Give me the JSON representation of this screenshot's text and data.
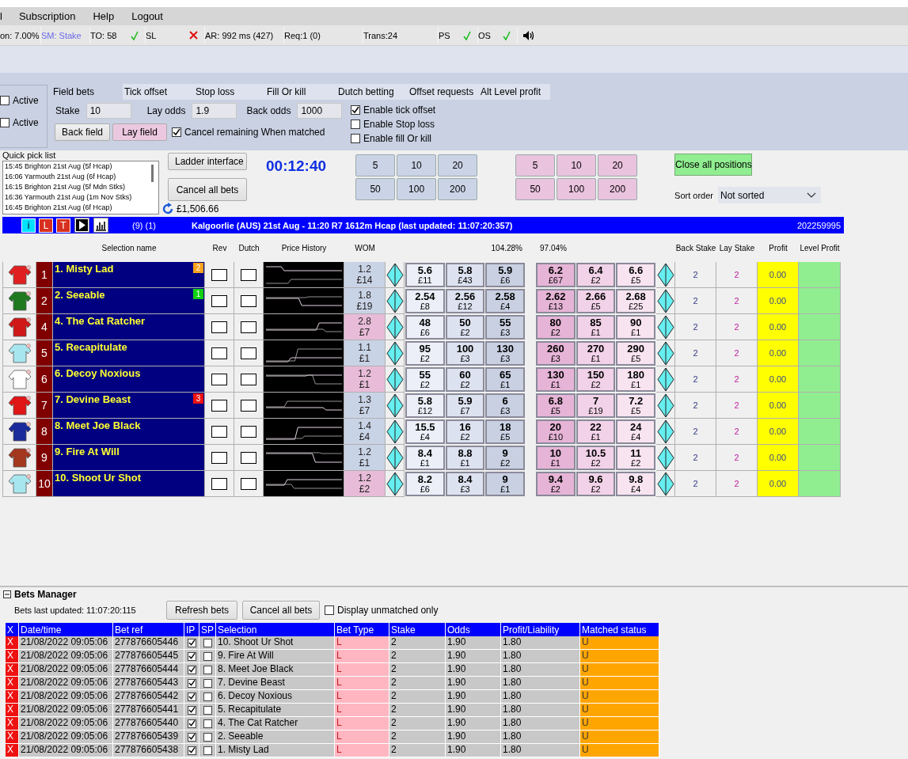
{
  "menu": [
    "l",
    "Subscription",
    "Help",
    "Logout"
  ],
  "status_bar": [
    {
      "text": "on: 7.00%",
      "kind": "plain"
    },
    {
      "text": "SM: Stake",
      "kind": "link"
    },
    {
      "text": "TO: 58",
      "kind": "plain",
      "ok": true
    },
    {
      "text": "SL",
      "kind": "plain",
      "ok": false
    },
    {
      "text": "AR: 992 ms (427)",
      "kind": "plain"
    },
    {
      "text": "Req:1 (0)",
      "kind": "plain"
    },
    {
      "text": "Trans:24",
      "kind": "plain"
    },
    {
      "text": "PS",
      "kind": "plain",
      "ok": true
    },
    {
      "text": "OS",
      "kind": "plain",
      "ok": true
    }
  ],
  "active_toggles": [
    {
      "label": "Active",
      "checked": false
    },
    {
      "label": "Active",
      "checked": false
    }
  ],
  "settings_tabs": [
    {
      "label": "Field bets",
      "selected": true
    },
    {
      "label": "Tick offset",
      "selected": false
    },
    {
      "label": "Stop loss",
      "selected": false
    },
    {
      "label": "Fill Or kill",
      "selected": false
    },
    {
      "label": "Dutch betting",
      "selected": false
    },
    {
      "label": "Offset requests",
      "selected": false
    },
    {
      "label": "Alt Level profit",
      "selected": false
    }
  ],
  "field_bets": {
    "fields": [
      {
        "label": "Stake",
        "value": "10"
      },
      {
        "label": "Lay odds",
        "value": "1.9"
      },
      {
        "label": "Back odds",
        "value": "1000"
      }
    ],
    "buttons": [
      {
        "label": "Back field",
        "kind": "back"
      },
      {
        "label": "Lay field",
        "kind": "lay"
      }
    ],
    "cancel_remaining": {
      "label": "Cancel remaining When matched",
      "checked": true
    }
  },
  "options": [
    {
      "label": "Enable tick offset",
      "checked": true
    },
    {
      "label": "Enable Stop loss",
      "checked": false
    },
    {
      "label": "Enable fill Or kill",
      "checked": false
    }
  ],
  "quick_pick_list": {
    "title": "Quick pick list",
    "items": [
      "15:45 Brighton 21st Aug (5f Hcap)",
      "16:06 Yarmouth 21st Aug (6f Hcap)",
      "16:15 Brighton 21st Aug (5f Mdn Stks)",
      "16:36 Yarmouth 21st Aug (1m Nov Stks)",
      "16:45 Brighton 21st Aug (6f Hcap)"
    ]
  },
  "ladder_button": "Ladder interface",
  "cancel_all_button": "Cancel all bets",
  "balance": "£1,506.66",
  "timer": "00:12:40",
  "back_stakes": [
    "5",
    "10",
    "20",
    "50",
    "100",
    "200"
  ],
  "lay_stakes": [
    "5",
    "10",
    "20",
    "50",
    "100",
    "200"
  ],
  "close_all_button": "Close all positions",
  "sort_order": {
    "label": "Sort order",
    "value": "Not sorted"
  },
  "market_bar": {
    "tool_buttons": [
      {
        "label": "i",
        "kind": "info"
      },
      {
        "label": "L",
        "kind": "alert"
      },
      {
        "label": "T",
        "kind": "alert"
      }
    ],
    "counts": "(9) (1)",
    "title": "Kalgoorlie (AUS) 21st Aug - 11:20 R7 1612m Hcap (last updated: 11:07:20:357)",
    "market_id": "202259995"
  },
  "grid_header": {
    "selection": "Selection name",
    "rev": "Rev",
    "dutch": "Dutch",
    "history": "Price History",
    "wom": "WOM",
    "back_book": "104.28%",
    "lay_book": "97.04%",
    "back_stake": "Back Stake",
    "lay_stake": "Lay Stake",
    "profit": "Profit",
    "level_profit": "Level Profit"
  },
  "runners": [
    {
      "number": "1",
      "name": "1. Misty Lad",
      "badge": {
        "text": "2",
        "color": "#f7a21b"
      },
      "silk": {
        "color": "#e02020"
      },
      "rev": false,
      "dutch": false,
      "wom": {
        "price": "1.2",
        "amount": "£14",
        "color": "#c9d3e6"
      },
      "back": [
        {
          "price": "5.6",
          "amount": "£11"
        },
        {
          "price": "5.8",
          "amount": "£43"
        },
        {
          "price": "5.9",
          "amount": "£6"
        }
      ],
      "lay": [
        {
          "price": "6.2",
          "amount": "£67"
        },
        {
          "price": "6.4",
          "amount": "£2"
        },
        {
          "price": "6.6",
          "amount": "£5"
        }
      ],
      "back_stake": "2",
      "lay_stake": "2",
      "profit": "0.00"
    },
    {
      "number": "2",
      "name": "2. Seeable",
      "badge": {
        "text": "1",
        "color": "#10d010"
      },
      "silk": {
        "color": "#1f7a1f"
      },
      "rev": false,
      "dutch": false,
      "wom": {
        "price": "1.8",
        "amount": "£19",
        "color": "#c9d3e6"
      },
      "back": [
        {
          "price": "2.54",
          "amount": "£8"
        },
        {
          "price": "2.56",
          "amount": "£12"
        },
        {
          "price": "2.58",
          "amount": "£4"
        }
      ],
      "lay": [
        {
          "price": "2.62",
          "amount": "£13"
        },
        {
          "price": "2.66",
          "amount": "£5"
        },
        {
          "price": "2.68",
          "amount": "£25"
        }
      ],
      "back_stake": "2",
      "lay_stake": "2",
      "profit": "0.00"
    },
    {
      "number": "4",
      "name": "4. The Cat Ratcher",
      "silk": {
        "color": "#d01818"
      },
      "rev": false,
      "dutch": false,
      "wom": {
        "price": "2.8",
        "amount": "£7",
        "color": "#e8bcd8"
      },
      "back": [
        {
          "price": "48",
          "amount": "£6"
        },
        {
          "price": "50",
          "amount": "£2"
        },
        {
          "price": "55",
          "amount": "£3"
        }
      ],
      "lay": [
        {
          "price": "80",
          "amount": "£2"
        },
        {
          "price": "85",
          "amount": "£1"
        },
        {
          "price": "90",
          "amount": "£1"
        }
      ],
      "back_stake": "2",
      "lay_stake": "2",
      "profit": "0.00"
    },
    {
      "number": "5",
      "name": "5. Recapitulate",
      "silk": {
        "color": "#a8e6ef"
      },
      "rev": false,
      "dutch": false,
      "wom": {
        "price": "1.1",
        "amount": "£1",
        "color": "#c9d3e6"
      },
      "back": [
        {
          "price": "95",
          "amount": "£2"
        },
        {
          "price": "100",
          "amount": "£3"
        },
        {
          "price": "130",
          "amount": "£3"
        }
      ],
      "lay": [
        {
          "price": "260",
          "amount": "£3"
        },
        {
          "price": "270",
          "amount": "£1"
        },
        {
          "price": "290",
          "amount": "£5"
        }
      ],
      "back_stake": "2",
      "lay_stake": "2",
      "profit": "0.00"
    },
    {
      "number": "6",
      "name": "6. Decoy Noxious",
      "silk": {
        "color": "#ffffff"
      },
      "rev": false,
      "dutch": false,
      "wom": {
        "price": "1.2",
        "amount": "£1",
        "color": "#e8bcd8"
      },
      "back": [
        {
          "price": "55",
          "amount": "£2"
        },
        {
          "price": "60",
          "amount": "£2"
        },
        {
          "price": "65",
          "amount": "£1"
        }
      ],
      "lay": [
        {
          "price": "130",
          "amount": "£1"
        },
        {
          "price": "150",
          "amount": "£2"
        },
        {
          "price": "180",
          "amount": "£1"
        }
      ],
      "back_stake": "2",
      "lay_stake": "2",
      "profit": "0.00"
    },
    {
      "number": "7",
      "name": "7. Devine Beast",
      "badge": {
        "text": "3",
        "color": "#ee1111"
      },
      "silk": {
        "color": "#e01515"
      },
      "rev": false,
      "dutch": false,
      "wom": {
        "price": "1.3",
        "amount": "£7",
        "color": "#c9d3e6"
      },
      "back": [
        {
          "price": "5.8",
          "amount": "£12"
        },
        {
          "price": "5.9",
          "amount": "£7"
        },
        {
          "price": "6",
          "amount": "£3"
        }
      ],
      "lay": [
        {
          "price": "6.8",
          "amount": "£5"
        },
        {
          "price": "7",
          "amount": "£19"
        },
        {
          "price": "7.2",
          "amount": "£5"
        }
      ],
      "back_stake": "2",
      "lay_stake": "2",
      "profit": "0.00"
    },
    {
      "number": "8",
      "name": "8. Meet Joe Black",
      "silk": {
        "color": "#1a2a9a"
      },
      "rev": false,
      "dutch": false,
      "wom": {
        "price": "1.4",
        "amount": "£4",
        "color": "#c9d3e6"
      },
      "back": [
        {
          "price": "15.5",
          "amount": "£4"
        },
        {
          "price": "16",
          "amount": "£2"
        },
        {
          "price": "18",
          "amount": "£5"
        }
      ],
      "lay": [
        {
          "price": "20",
          "amount": "£10"
        },
        {
          "price": "22",
          "amount": "£1"
        },
        {
          "price": "24",
          "amount": "£4"
        }
      ],
      "back_stake": "2",
      "lay_stake": "2",
      "profit": "0.00"
    },
    {
      "number": "9",
      "name": "9. Fire At Will",
      "silk": {
        "color": "#a3381f"
      },
      "rev": false,
      "dutch": false,
      "wom": {
        "price": "1.2",
        "amount": "£1",
        "color": "#c9d3e6"
      },
      "back": [
        {
          "price": "8.4",
          "amount": "£1"
        },
        {
          "price": "8.8",
          "amount": "£1"
        },
        {
          "price": "9",
          "amount": "£2"
        }
      ],
      "lay": [
        {
          "price": "10",
          "amount": "£1"
        },
        {
          "price": "10.5",
          "amount": "£2"
        },
        {
          "price": "11",
          "amount": "£2"
        }
      ],
      "back_stake": "2",
      "lay_stake": "2",
      "profit": "0.00"
    },
    {
      "number": "10",
      "name": "10. Shoot Ur Shot",
      "silk": {
        "color": "#a8e6ef"
      },
      "rev": false,
      "dutch": false,
      "wom": {
        "price": "1.2",
        "amount": "£2",
        "color": "#e8bcd8"
      },
      "back": [
        {
          "price": "8.2",
          "amount": "£6"
        },
        {
          "price": "8.4",
          "amount": "£3"
        },
        {
          "price": "9",
          "amount": "£1"
        }
      ],
      "lay": [
        {
          "price": "9.4",
          "amount": "£2"
        },
        {
          "price": "9.6",
          "amount": "£2"
        },
        {
          "price": "9.8",
          "amount": "£4"
        }
      ],
      "back_stake": "2",
      "lay_stake": "2",
      "profit": "0.00"
    }
  ],
  "bets_manager": {
    "title": "Bets Manager",
    "last_updated": "Bets last updated: 11:07:20:115",
    "buttons": [
      "Refresh bets",
      "Cancel all bets"
    ],
    "unmatched_only": {
      "label": "Display unmatched only",
      "checked": false
    },
    "columns": [
      "X",
      "Date/time",
      "Bet ref",
      "IP",
      "SP",
      "Selection",
      "Bet Type",
      "Stake",
      "Odds",
      "Profit/Liability",
      "Matched status"
    ],
    "rows": [
      {
        "cancel": "X",
        "date": "21/08/2022 09:05:06",
        "ref": "277876605446",
        "ip": true,
        "sp": false,
        "selection": "10. Shoot Ur Shot",
        "bet_type": "L",
        "stake": "2",
        "odds": "1.90",
        "profit": "1.80",
        "status": "U"
      },
      {
        "cancel": "X",
        "date": "21/08/2022 09:05:06",
        "ref": "277876605445",
        "ip": true,
        "sp": false,
        "selection": "9. Fire At Will",
        "bet_type": "L",
        "stake": "2",
        "odds": "1.90",
        "profit": "1.80",
        "status": "U"
      },
      {
        "cancel": "X",
        "date": "21/08/2022 09:05:06",
        "ref": "277876605444",
        "ip": true,
        "sp": false,
        "selection": "8. Meet Joe Black",
        "bet_type": "L",
        "stake": "2",
        "odds": "1.90",
        "profit": "1.80",
        "status": "U"
      },
      {
        "cancel": "X",
        "date": "21/08/2022 09:05:06",
        "ref": "277876605443",
        "ip": true,
        "sp": false,
        "selection": "7. Devine Beast",
        "bet_type": "L",
        "stake": "2",
        "odds": "1.90",
        "profit": "1.80",
        "status": "U"
      },
      {
        "cancel": "X",
        "date": "21/08/2022 09:05:06",
        "ref": "277876605442",
        "ip": true,
        "sp": false,
        "selection": "6. Decoy Noxious",
        "bet_type": "L",
        "stake": "2",
        "odds": "1.90",
        "profit": "1.80",
        "status": "U"
      },
      {
        "cancel": "X",
        "date": "21/08/2022 09:05:06",
        "ref": "277876605441",
        "ip": true,
        "sp": false,
        "selection": "5. Recapitulate",
        "bet_type": "L",
        "stake": "2",
        "odds": "1.90",
        "profit": "1.80",
        "status": "U"
      },
      {
        "cancel": "X",
        "date": "21/08/2022 09:05:06",
        "ref": "277876605440",
        "ip": true,
        "sp": false,
        "selection": "4. The Cat Ratcher",
        "bet_type": "L",
        "stake": "2",
        "odds": "1.90",
        "profit": "1.80",
        "status": "U"
      },
      {
        "cancel": "X",
        "date": "21/08/2022 09:05:06",
        "ref": "277876605439",
        "ip": true,
        "sp": false,
        "selection": "2. Seeable",
        "bet_type": "L",
        "stake": "2",
        "odds": "1.90",
        "profit": "1.80",
        "status": "U"
      },
      {
        "cancel": "X",
        "date": "21/08/2022 09:05:06",
        "ref": "277876605438",
        "ip": true,
        "sp": false,
        "selection": "1. Misty Lad",
        "bet_type": "L",
        "stake": "2",
        "odds": "1.90",
        "profit": "1.80",
        "status": "U"
      }
    ]
  }
}
